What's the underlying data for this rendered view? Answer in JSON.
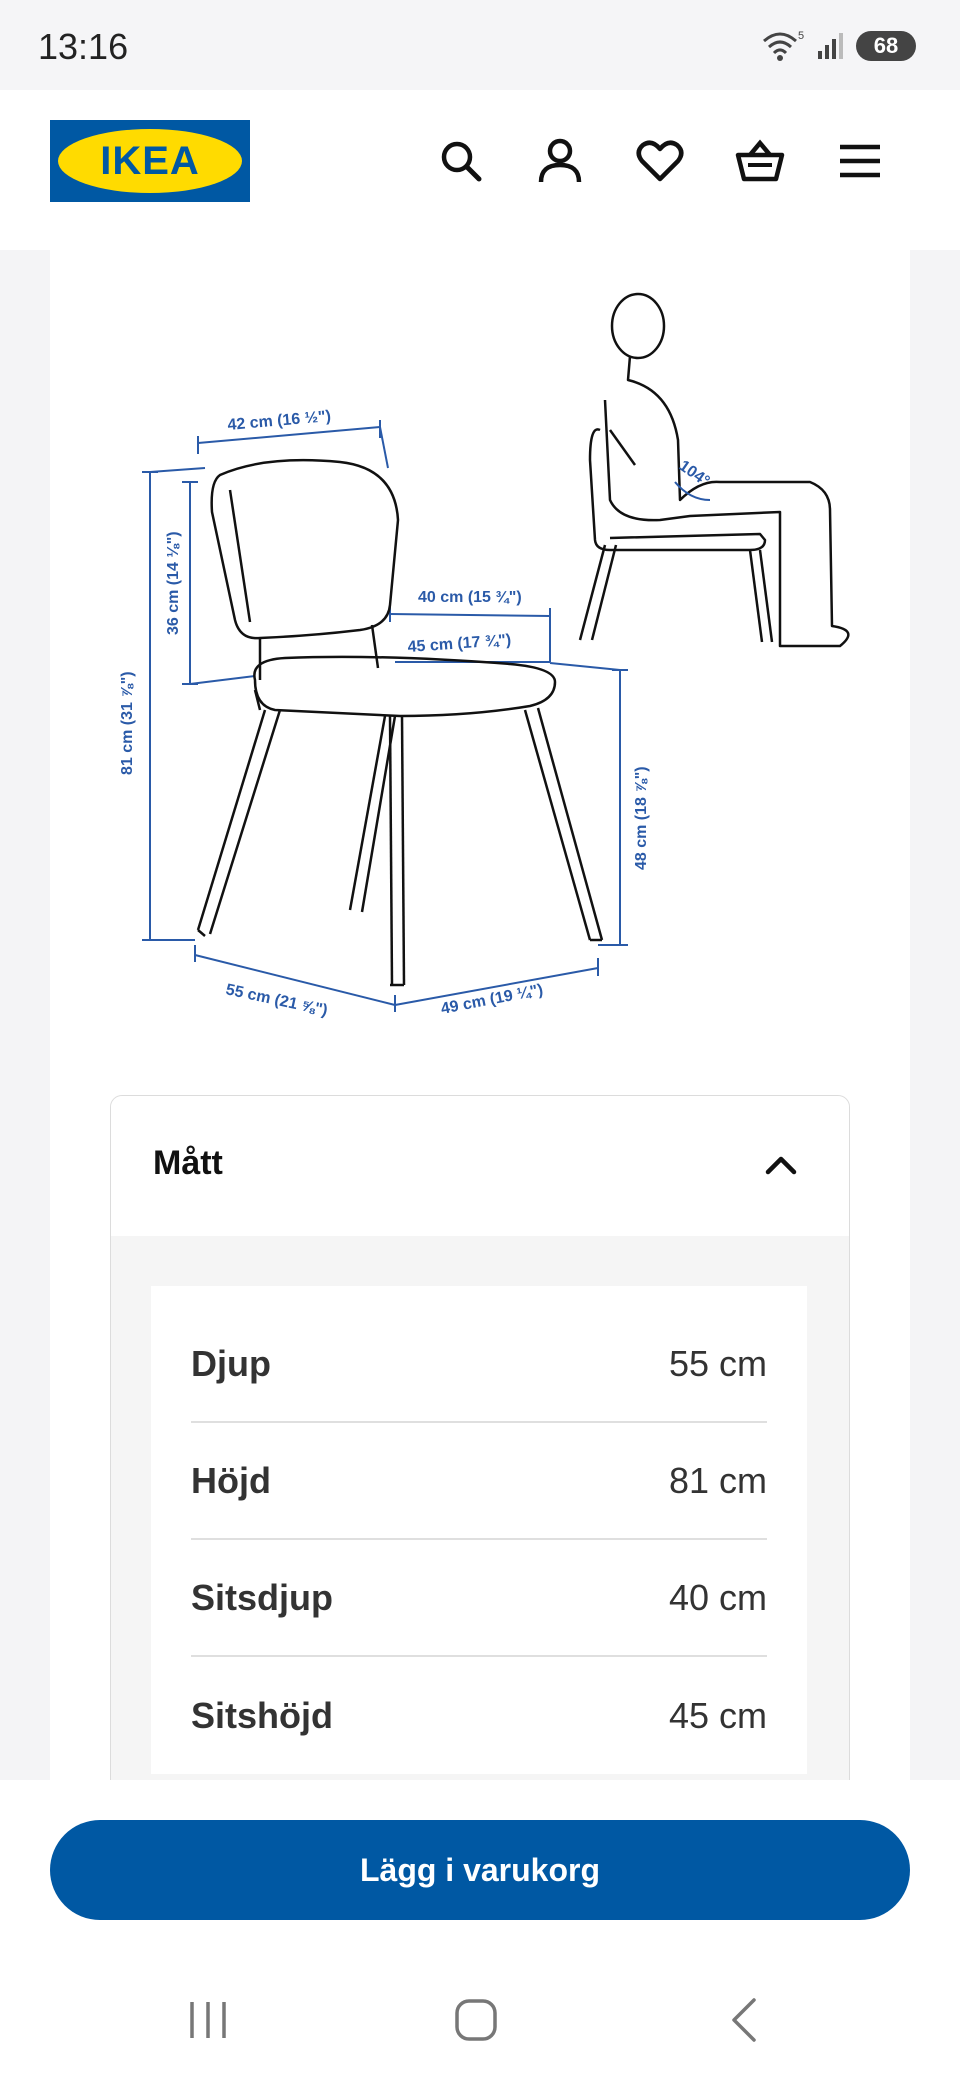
{
  "status": {
    "time": "13:16",
    "battery": "68",
    "wifi_badge": "5"
  },
  "brand": {
    "logo_text": "IKEA"
  },
  "header": {
    "icons": [
      "search-icon",
      "user-icon",
      "heart-icon",
      "basket-icon",
      "menu-icon"
    ]
  },
  "diagram": {
    "labels": {
      "backrest_width": "42 cm (16 ½\")",
      "total_height": "81 cm (31 ⅞\")",
      "backrest_height": "36 cm (14 ⅛\")",
      "seat_depth": "40 cm (15 ¾\")",
      "seat_width": "45 cm (17 ¾\")",
      "seat_height": "48 cm (18 ⅞\")",
      "depth": "55 cm (21 ⅝\")",
      "width": "49 cm (19 ¼\")",
      "angle": "104°"
    }
  },
  "dimensions": {
    "title": "Mått",
    "rows": [
      {
        "label": "Djup",
        "value": "55 cm"
      },
      {
        "label": "Höjd",
        "value": "81 cm"
      },
      {
        "label": "Sitsdjup",
        "value": "40 cm"
      },
      {
        "label": "Sitshöjd",
        "value": "45 cm"
      }
    ]
  },
  "cta": {
    "label": "Lägg i varukorg"
  },
  "colors": {
    "brand_blue": "#0058a3",
    "brand_yellow": "#ffdb00",
    "dimension_blue": "#2a5aa8"
  }
}
